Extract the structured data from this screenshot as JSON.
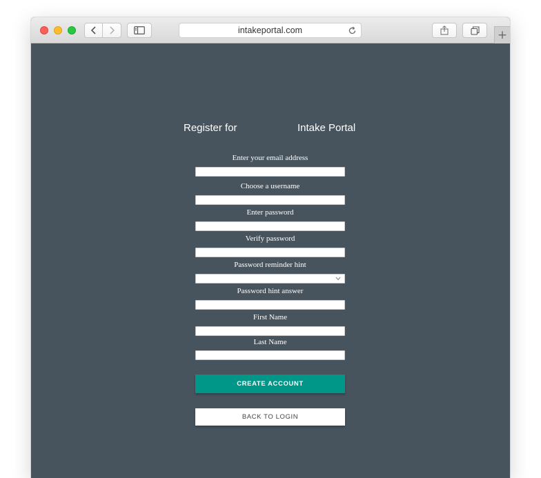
{
  "browser": {
    "address": "intakeportal.com",
    "icons": {
      "back": "chevron-left-icon",
      "forward": "chevron-right-icon",
      "sidebar": "sidebar-icon",
      "reload": "reload-icon",
      "share": "share-icon",
      "tabs": "tabs-icon",
      "new_tab": "plus-icon"
    },
    "new_tab_glyph": "+"
  },
  "colors": {
    "page_background": "#47545e",
    "primary_button": "#009688",
    "secondary_button": "#ffffff"
  },
  "form": {
    "heading_left": "Register for",
    "heading_right": "Intake Portal",
    "fields": [
      {
        "label": "Enter your email address",
        "value": ""
      },
      {
        "label": "Choose a username",
        "value": ""
      },
      {
        "label": "Enter password",
        "value": ""
      },
      {
        "label": "Verify password",
        "value": ""
      },
      {
        "label": "Password reminder hint",
        "value": ""
      },
      {
        "label": "Password hint answer",
        "value": ""
      },
      {
        "label": "First Name",
        "value": ""
      },
      {
        "label": "Last Name",
        "value": ""
      }
    ],
    "create_button": "CREATE ACCOUNT",
    "back_button": "BACK TO LOGIN"
  }
}
